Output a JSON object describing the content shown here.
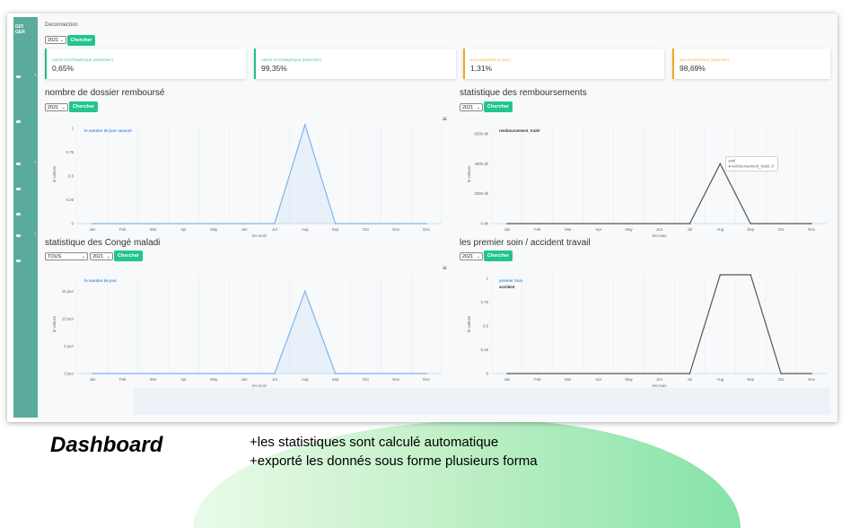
{
  "topbar": {
    "logout_label": "Deconnection",
    "year_value": "2021",
    "search_label": "Chercher"
  },
  "sidebar": {
    "brand_lines": [
      "GIO",
      "GER"
    ],
    "items": [
      {
        "name": "sidebar-item-1",
        "has_chevron": true
      },
      {
        "name": "sidebar-item-2",
        "has_chevron": false
      },
      {
        "name": "sidebar-item-3",
        "has_chevron": true
      },
      {
        "name": "sidebar-item-4",
        "has_chevron": false
      },
      {
        "name": "sidebar-item-5",
        "has_chevron": false
      },
      {
        "name": "sidebar-item-6",
        "has_chevron": true
      },
      {
        "name": "sidebar-item-7",
        "has_chevron": false
      }
    ],
    "color": "#5aab9b"
  },
  "cards": [
    {
      "label": "VISITE SYSTEMATIQUE (MONTANT)",
      "value": "0,65%",
      "color": "#1fbf8f"
    },
    {
      "label": "VISITE SYSTEMATIQUE (NON FAIT)",
      "value": "99,35%",
      "color": "#1fbf8f"
    },
    {
      "label": "AUTOCONTROLE (FAIT)",
      "value": "1,31%",
      "color": "#f5a623"
    },
    {
      "label": "AUTOCONTROLE (NON FAIT)",
      "value": "98,69%",
      "color": "#f5a623"
    }
  ],
  "charts": [
    {
      "title": "nombre de dossier remboursé",
      "year": "2021",
      "search": "Chercher",
      "filter": "",
      "menu_icon": "hamburger-icon",
      "legend_extra": ""
    },
    {
      "title": "statistique des remboursements",
      "year": "2021",
      "search": "Chercher",
      "filter": "",
      "menu_icon": "",
      "legend_extra": "",
      "tooltip": {
        "month": "avril",
        "series": "remboursement_traité",
        "value": "0"
      }
    },
    {
      "title": "statistique des Congé maladi",
      "year": "2021",
      "search": "Chercher",
      "filter": "TOUS",
      "menu_icon": "hamburger-icon",
      "legend_extra": ""
    },
    {
      "title": "les premier soin / accident travail",
      "year": "2021",
      "search": "Chercher",
      "filter": "",
      "menu_icon": "",
      "legend_extra": "accident"
    }
  ],
  "chart_data": [
    {
      "type": "area",
      "months": [
        "Jan",
        "Feb",
        "Mar",
        "Apr",
        "May",
        "Jun",
        "Jul",
        "Aug",
        "Sep",
        "Oct",
        "Nov",
        "Dec"
      ],
      "series": [
        {
          "name": "le nombre de jour rassuré",
          "values": [
            0,
            0,
            0,
            0,
            0,
            0,
            0,
            1,
            0,
            0,
            0,
            0
          ]
        }
      ],
      "yticks": [
        "0",
        "0.25",
        "0.5",
        "0.75",
        "1"
      ],
      "ylim": [
        0,
        1
      ],
      "xlabel": "les mois",
      "ylabel": "le valeurs",
      "colors": [
        "#7cb5ec"
      ]
    },
    {
      "type": "line",
      "months": [
        "Jan",
        "Feb",
        "Mar",
        "Apr",
        "May",
        "Jun",
        "Jul",
        "Aug",
        "Sep",
        "Oct",
        "Nov"
      ],
      "series": [
        {
          "name": "remboursement_traité",
          "values": [
            0,
            0,
            0,
            0,
            0,
            0,
            0,
            4000,
            0,
            0,
            0
          ]
        }
      ],
      "yticks": [
        "0 dh",
        "2000 dh",
        "4000 dh",
        "6000 dh"
      ],
      "ylim": [
        0,
        6600
      ],
      "xlabel": "les mois",
      "ylabel": "le valeurs",
      "colors": [
        "#555555"
      ]
    },
    {
      "type": "area",
      "months": [
        "Jan",
        "Feb",
        "Mar",
        "Apr",
        "May",
        "Jun",
        "Jul",
        "Aug",
        "Sep",
        "Oct",
        "Nov",
        "Dec"
      ],
      "series": [
        {
          "name": "le nombre de jour",
          "values": [
            0,
            0,
            0,
            0,
            0,
            0,
            0,
            15,
            0,
            0,
            0,
            0
          ]
        }
      ],
      "yticks": [
        "0 jour",
        "5 jour",
        "10 jour",
        "15 jour"
      ],
      "ylim": [
        0,
        18
      ],
      "xlabel": "les mois",
      "ylabel": "le valeurs",
      "colors": [
        "#7cb5ec"
      ]
    },
    {
      "type": "line",
      "months": [
        "Jan",
        "Feb",
        "Mar",
        "Apr",
        "May",
        "Jun",
        "Jul",
        "Aug",
        "Sep",
        "Oct",
        "Nov"
      ],
      "series": [
        {
          "name": "premier Soin",
          "values": [
            0,
            0,
            0,
            0,
            0,
            0,
            0,
            1,
            1,
            0,
            0
          ]
        }
      ],
      "yticks": [
        "0",
        "0.25",
        "0.5",
        "0.75",
        "1"
      ],
      "ylim": [
        0,
        1
      ],
      "xlabel": "les mois",
      "ylabel": "le valeurs",
      "colors": [
        "#555555"
      ]
    }
  ],
  "slide": {
    "caption": "Dashboard",
    "notes": [
      "+les statistiques sont calculé automatique",
      "+exporté les donnés sous forme plusieurs forma"
    ]
  }
}
